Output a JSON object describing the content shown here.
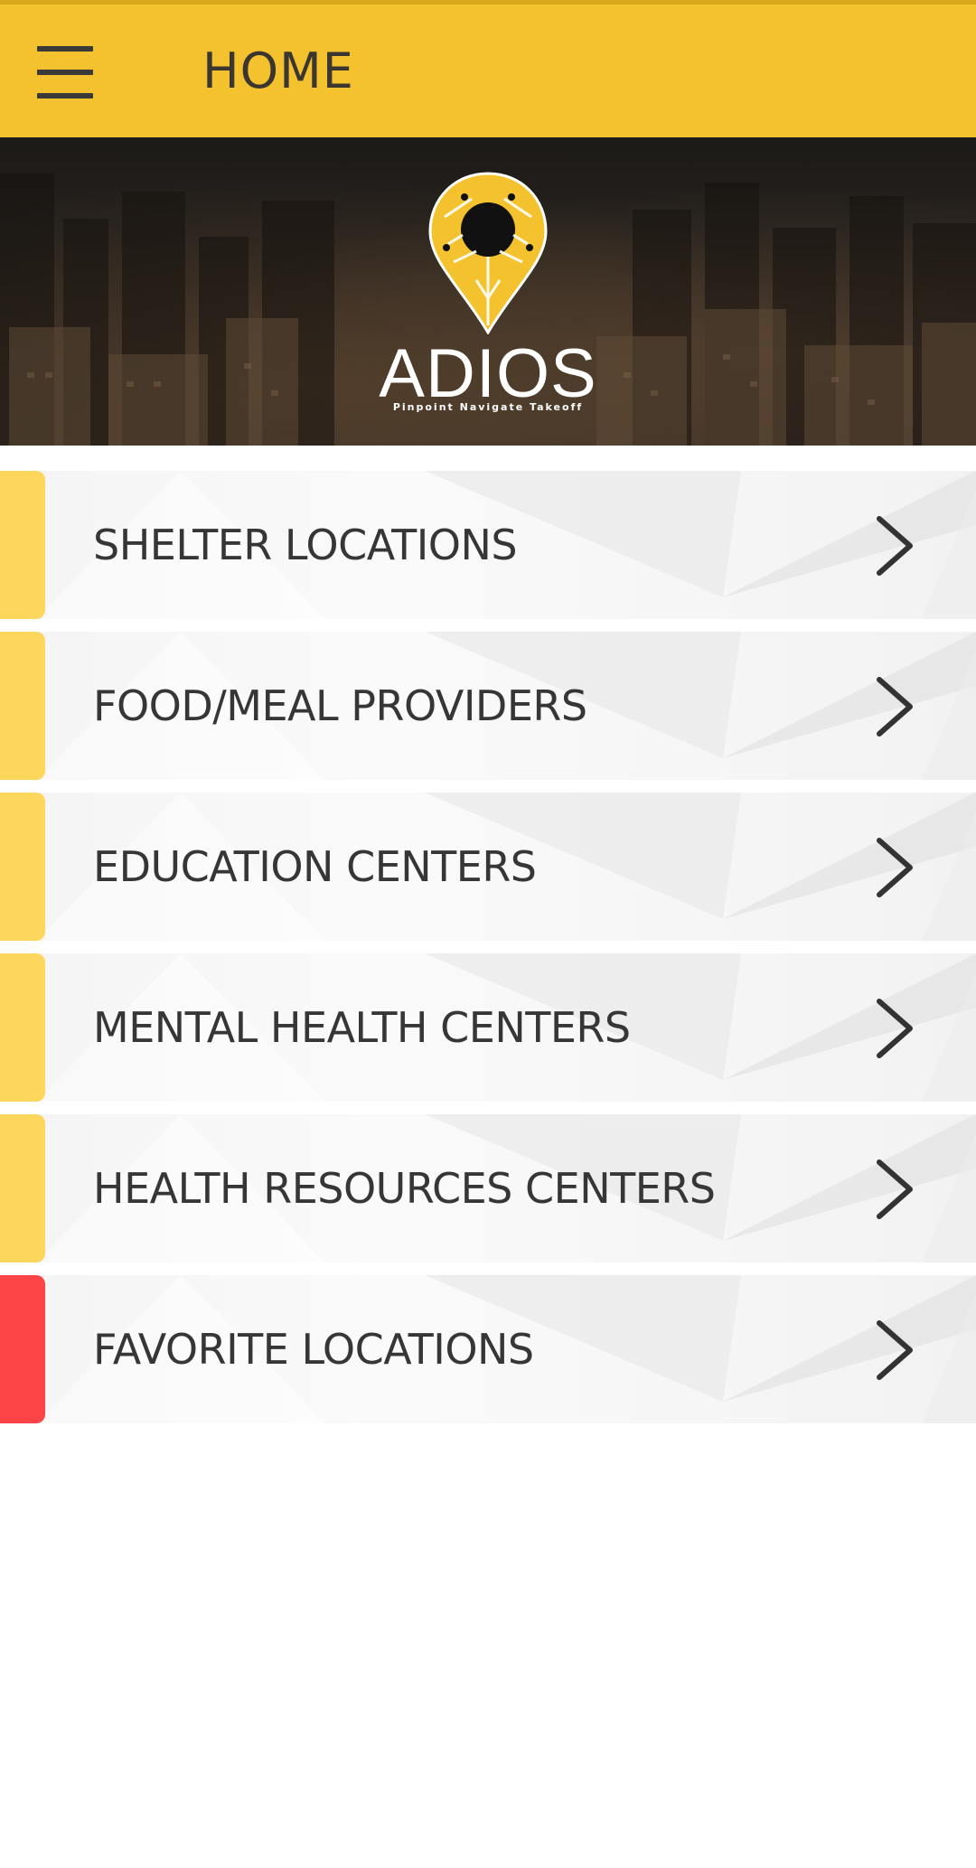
{
  "app_bar": {
    "title": "HOME",
    "menu_icon": "hamburger-menu-icon"
  },
  "hero": {
    "logo_icon": "map-pin-logo-icon",
    "brand": "ADIOS",
    "tagline": "Pinpoint Navigate Takeoff"
  },
  "colors": {
    "app_bar": "#f4c22e",
    "accent_yellow": "#fdd65c",
    "accent_red": "#fc4446",
    "text_dark": "#363636"
  },
  "menu": {
    "items": [
      {
        "label": "SHELTER LOCATIONS",
        "accent": "#fdd65c",
        "icon": "chevron-right-icon"
      },
      {
        "label": "FOOD/MEAL PROVIDERS",
        "accent": "#fdd65c",
        "icon": "chevron-right-icon"
      },
      {
        "label": "EDUCATION CENTERS",
        "accent": "#fdd65c",
        "icon": "chevron-right-icon"
      },
      {
        "label": "MENTAL HEALTH CENTERS",
        "accent": "#fdd65c",
        "icon": "chevron-right-icon"
      },
      {
        "label": "HEALTH RESOURCES CENTERS",
        "accent": "#fdd65c",
        "icon": "chevron-right-icon"
      },
      {
        "label": "FAVORITE LOCATIONS",
        "accent": "#fc4446",
        "icon": "chevron-right-icon"
      }
    ]
  }
}
